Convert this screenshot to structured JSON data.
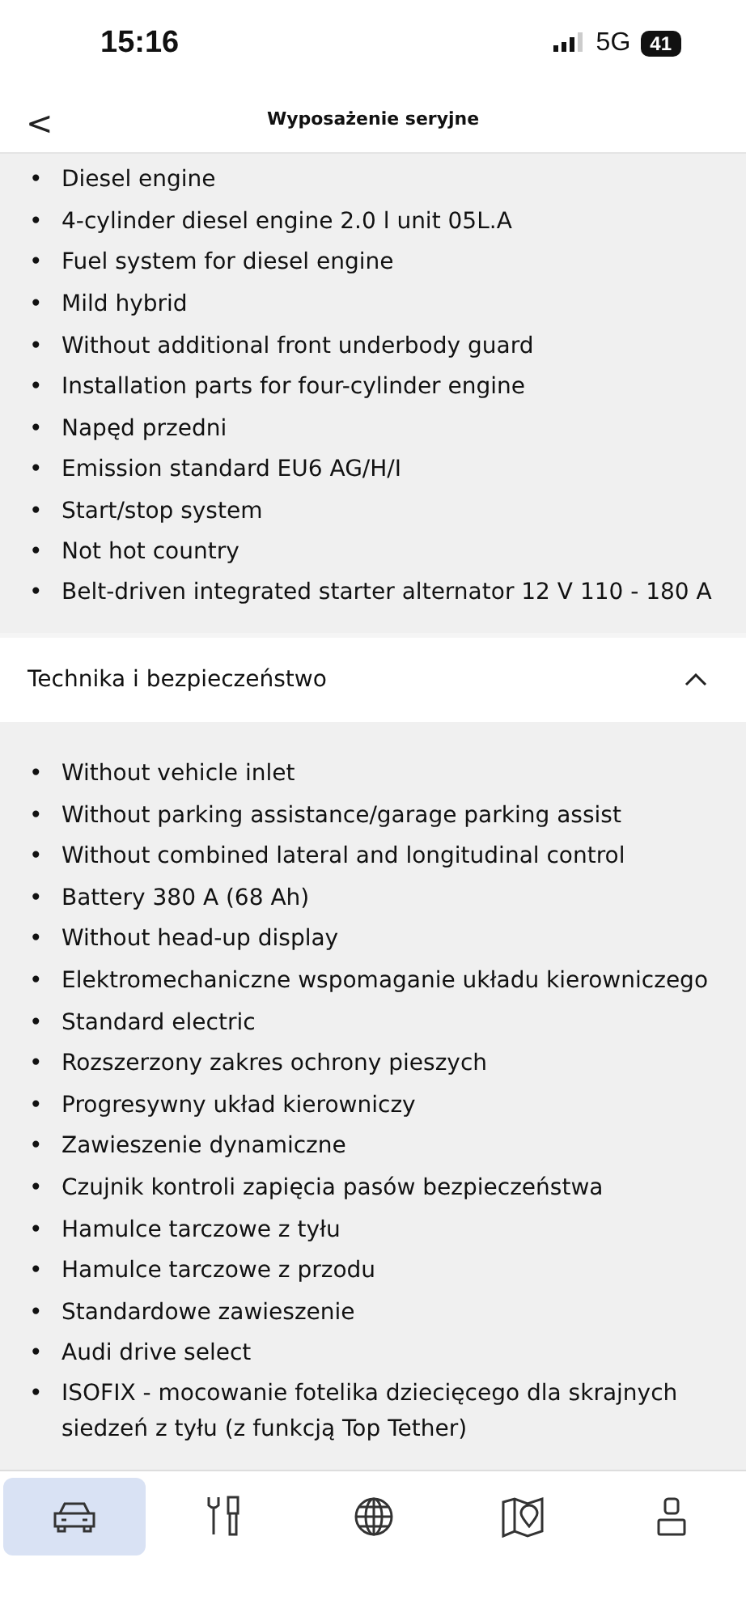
{
  "status_bar": {
    "time": "15:16",
    "network": "5G",
    "battery": "41"
  },
  "header": {
    "back": "<",
    "title": "Wyposażenie seryjne"
  },
  "sections": [
    {
      "bullet": "•",
      "items": [
        "Diesel engine",
        "4-cylinder diesel engine 2.0 l unit 05L.A",
        "Fuel system for diesel engine",
        "Mild hybrid",
        "Without additional front underbody guard",
        "Installation parts for four-cylinder engine",
        "Napęd przedni",
        "Emission standard EU6 AG/H/I",
        "Start/stop system",
        "Not hot country",
        "Belt-driven integrated starter alternator 12 V 110 - 180 A"
      ]
    },
    {
      "title": "Technika i bezpieczeństwo",
      "expanded": true,
      "bullet": "•",
      "items": [
        "Without vehicle inlet",
        "Without parking assistance/garage parking assist",
        "Without combined lateral and longitudinal control",
        "Battery 380 A (68 Ah)",
        "Without head-up display",
        "Elektromechaniczne wspomaganie układu kierowniczego",
        "Standard electric",
        "Rozszerzony zakres ochrony pieszych",
        "Progresywny układ kierowniczy",
        "Zawieszenie dynamiczne",
        "Czujnik kontroli zapięcia pasów bezpieczeństwa",
        "Hamulce tarczowe z tyłu",
        "Hamulce tarczowe z przodu",
        "Standardowe zawieszenie",
        "Audi drive select",
        "ISOFIX - mocowanie fotelika dziecięcego dla skrajnych siedzeń z tyłu (z funkcją Top Tether)"
      ]
    }
  ],
  "tab_bar": [
    {
      "kind": "car",
      "selected": true
    },
    {
      "kind": "tools",
      "selected": false
    },
    {
      "kind": "globe",
      "selected": false
    },
    {
      "kind": "map",
      "selected": false
    },
    {
      "kind": "person",
      "selected": false
    }
  ]
}
